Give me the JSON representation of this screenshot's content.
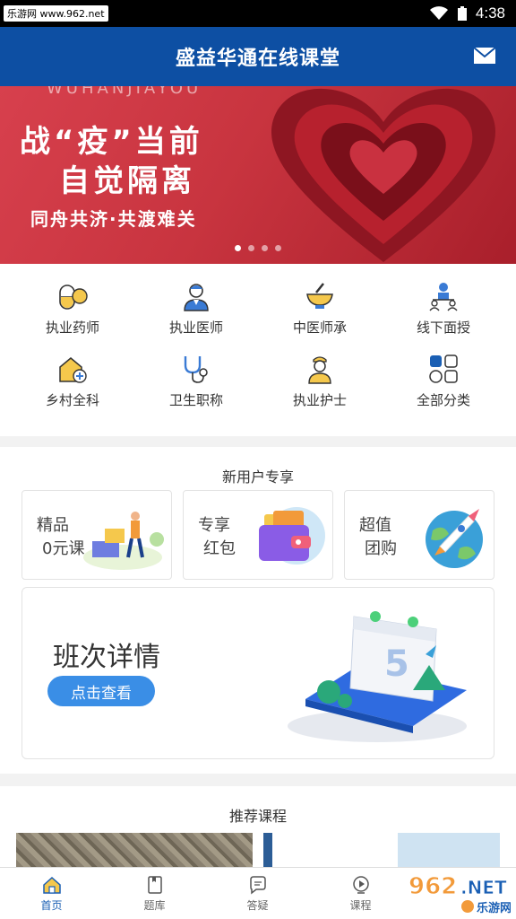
{
  "status_bar": {
    "site": "乐游网 www.962.net",
    "time": "4:38"
  },
  "app": {
    "title": "盛益华通在线课堂"
  },
  "banner": {
    "watermark": "WUHANJIAYOU",
    "line1": "战“疫”当前",
    "line2": "自觉隔离",
    "line3": "同舟共济·共渡难关",
    "active_dot": 0
  },
  "categories": [
    {
      "label": "执业药师",
      "icon": "pill-icon"
    },
    {
      "label": "执业医师",
      "icon": "doctor-icon"
    },
    {
      "label": "中医师承",
      "icon": "mortar-icon"
    },
    {
      "label": "线下面授",
      "icon": "lecture-icon"
    },
    {
      "label": "乡村全科",
      "icon": "village-icon"
    },
    {
      "label": "卫生职称",
      "icon": "stethoscope-icon"
    },
    {
      "label": "执业护士",
      "icon": "nurse-icon"
    },
    {
      "label": "全部分类",
      "icon": "grid-icon"
    }
  ],
  "new_user": {
    "title": "新用户专享",
    "promos": [
      {
        "line1": "精品",
        "line2": "0元课"
      },
      {
        "line1": "专享",
        "line2": "红包"
      },
      {
        "line1": "超值",
        "line2": "团购"
      }
    ],
    "detail": {
      "title": "班次详情",
      "button": "点击查看",
      "calendar_day": "5"
    }
  },
  "recommend": {
    "title": "推荐课程"
  },
  "tabs": [
    {
      "label": "首页",
      "icon": "home-icon",
      "active": true
    },
    {
      "label": "题库",
      "icon": "question-bank-icon",
      "active": false
    },
    {
      "label": "答疑",
      "icon": "chat-icon",
      "active": false
    },
    {
      "label": "课程",
      "icon": "play-icon",
      "active": false
    }
  ],
  "watermark_logo": {
    "text": "962.NET",
    "sub": "乐游网"
  },
  "colors": {
    "primary": "#0d4fa3",
    "accent": "#3a8ee6",
    "banner": "#c8343f"
  }
}
